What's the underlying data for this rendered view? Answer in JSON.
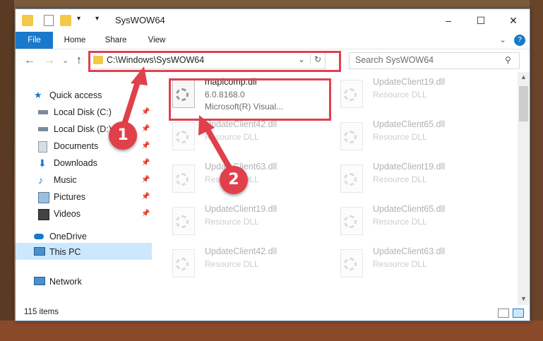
{
  "window": {
    "title": "SysWOW64",
    "minimize": "–",
    "maximize": "☐",
    "close": "✕"
  },
  "ribbon": {
    "tabs": [
      "File",
      "Home",
      "Share",
      "View"
    ],
    "collapse": "⌄",
    "help": "?"
  },
  "nav": {
    "back": "←",
    "forward": "→",
    "recent": "⌄",
    "up": "↑",
    "address": "C:\\Windows\\SysWOW64",
    "address_dropdown": "⌄",
    "refresh": "↻",
    "search_placeholder": "Search SysWOW64",
    "search_icon": "⚲"
  },
  "sidebar": {
    "items": [
      {
        "label": "Quick access",
        "icon": "star-icon",
        "pinned": false
      },
      {
        "label": "Local Disk (C:)",
        "icon": "drive-icon",
        "pinned": true
      },
      {
        "label": "Local Disk (D:)",
        "icon": "drive-icon",
        "pinned": true
      },
      {
        "label": "Documents",
        "icon": "documents-icon",
        "pinned": true
      },
      {
        "label": "Downloads",
        "icon": "download-icon",
        "pinned": true
      },
      {
        "label": "Music",
        "icon": "music-icon",
        "pinned": true
      },
      {
        "label": "Pictures",
        "icon": "pictures-icon",
        "pinned": true
      },
      {
        "label": "Videos",
        "icon": "videos-icon",
        "pinned": true
      },
      {
        "label": "OneDrive",
        "icon": "cloud-icon",
        "pinned": false
      },
      {
        "label": "This PC",
        "icon": "computer-icon",
        "pinned": false,
        "selected": true
      },
      {
        "label": "Network",
        "icon": "network-icon",
        "pinned": false
      }
    ],
    "pin_glyph": "📌"
  },
  "files": [
    {
      "name": "mapicomp.dll",
      "line2": "6.0.8168.0",
      "line3": "Microsoft(R) Visual...",
      "highlighted": true
    },
    {
      "name": "UpdateClient19.dll",
      "line2": "Resource DLL"
    },
    {
      "name": "UpdateClient42.dll",
      "line2": "Resource DLL"
    },
    {
      "name": "UpdateClient65.dll",
      "line2": "Resource DLL"
    },
    {
      "name": "UpdateClient63.dll",
      "line2": "Resource DLL"
    },
    {
      "name": "UpdateClient19.dll",
      "line2": "Resource DLL"
    },
    {
      "name": "UpdateClient19.dll",
      "line2": "Resource DLL"
    },
    {
      "name": "UpdateClient65.dll",
      "line2": "Resource DLL"
    },
    {
      "name": "UpdateClient42.dll",
      "line2": "Resource DLL"
    },
    {
      "name": "UpdateClient63.dll",
      "line2": "Resource DLL"
    }
  ],
  "status": {
    "item_count": "115 items"
  },
  "callouts": [
    "1",
    "2"
  ],
  "colors": {
    "accent": "#1979ca",
    "annotation": "#e04050",
    "selection": "#cce8ff"
  }
}
